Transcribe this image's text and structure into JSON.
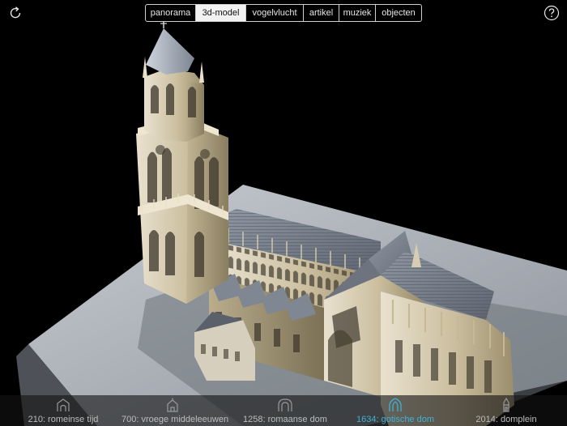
{
  "tabs": [
    {
      "label": "panorama",
      "active": false
    },
    {
      "label": "3d-model",
      "active": true
    },
    {
      "label": "vogelvlucht",
      "active": false
    },
    {
      "label": "artikel",
      "active": false
    },
    {
      "label": "muziek",
      "active": false
    },
    {
      "label": "objecten",
      "active": false
    }
  ],
  "corner": {
    "left_icon": "refresh-icon",
    "right_icon": "help-icon"
  },
  "timeline": [
    {
      "label": "210: romeinse tijd",
      "icon": "roman-gate-icon",
      "active": false
    },
    {
      "label": "700: vroege middeleeuwen",
      "icon": "early-church-icon",
      "active": false
    },
    {
      "label": "1258: romaanse dom",
      "icon": "romanesque-arch-icon",
      "active": false
    },
    {
      "label": "1634: gotische dom",
      "icon": "gothic-arch-icon",
      "active": true
    },
    {
      "label": "2014: domplein",
      "icon": "tower-icon",
      "active": false
    }
  ],
  "colors": {
    "accent": "#3fb2d4",
    "background": "#000000",
    "timeline_label": "#bdbdbd"
  }
}
